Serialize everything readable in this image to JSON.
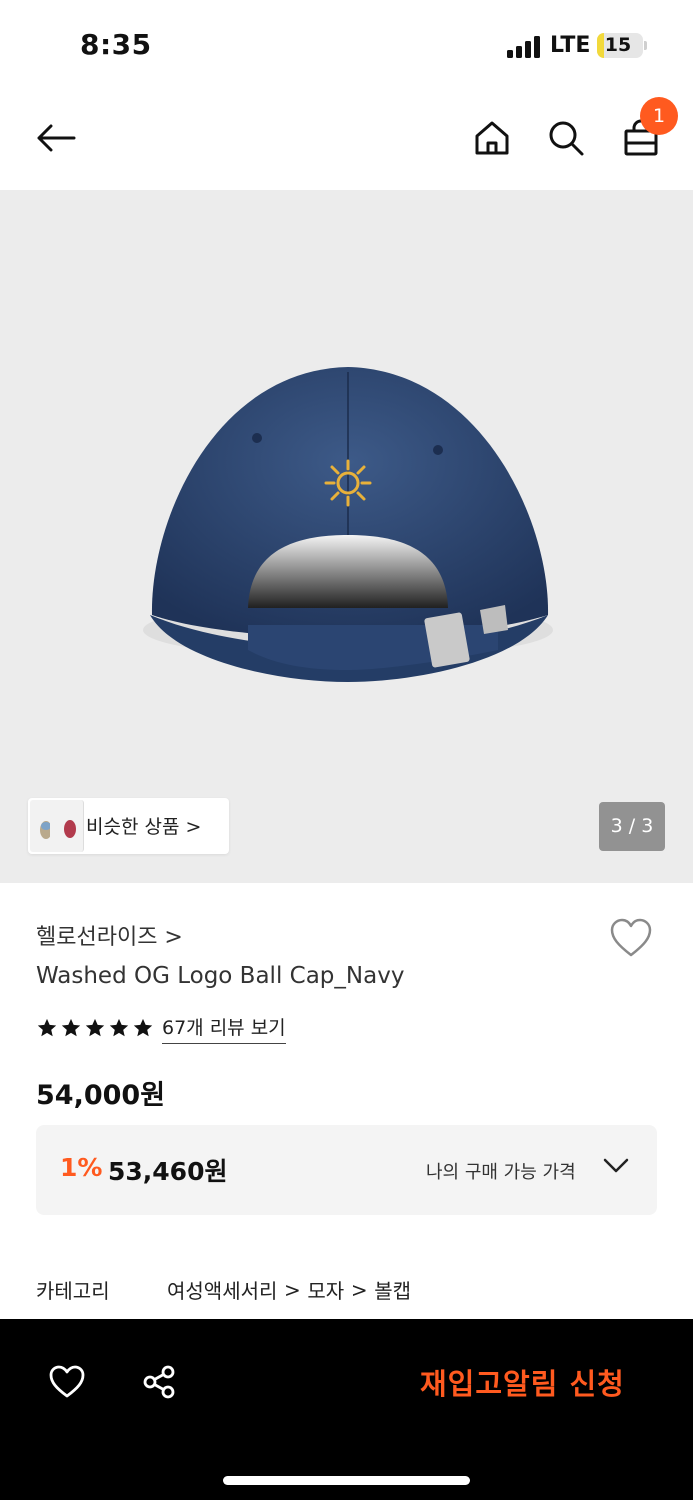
{
  "status_bar": {
    "time": "8:35",
    "network": "LTE",
    "battery_level": "15",
    "battery_fraction": 0.15
  },
  "nav": {
    "back_icon": "arrow-left-icon",
    "home_icon": "home-icon",
    "search_icon": "search-icon",
    "cart_icon": "shopping-bag-icon",
    "cart_count": "1"
  },
  "gallery": {
    "similar_label": "비슷한 상품 >",
    "counter": "3 / 3"
  },
  "product": {
    "brand": "헬로선라이즈 >",
    "title": "Washed OG Logo Ball Cap_Navy",
    "rating_stars": 5,
    "review_link": "67개 리뷰 보기",
    "price": "54,000원",
    "discount_rate": "1%",
    "discount_price": "53,460원",
    "my_price_label": "나의 구매 가능 가격"
  },
  "category": {
    "label": "카테고리",
    "path": [
      "여성액세서리",
      "모자",
      "볼캡"
    ],
    "separator": ">"
  },
  "bottom_bar": {
    "wishlist_icon": "heart-icon",
    "share_icon": "share-icon",
    "restock_label": "재입고알림 신청"
  },
  "colors": {
    "accent": "#ff5a1f",
    "gallery_bg": "#ececec",
    "price_box_bg": "#f4f4f4",
    "bottom_bar_bg": "#000000"
  }
}
